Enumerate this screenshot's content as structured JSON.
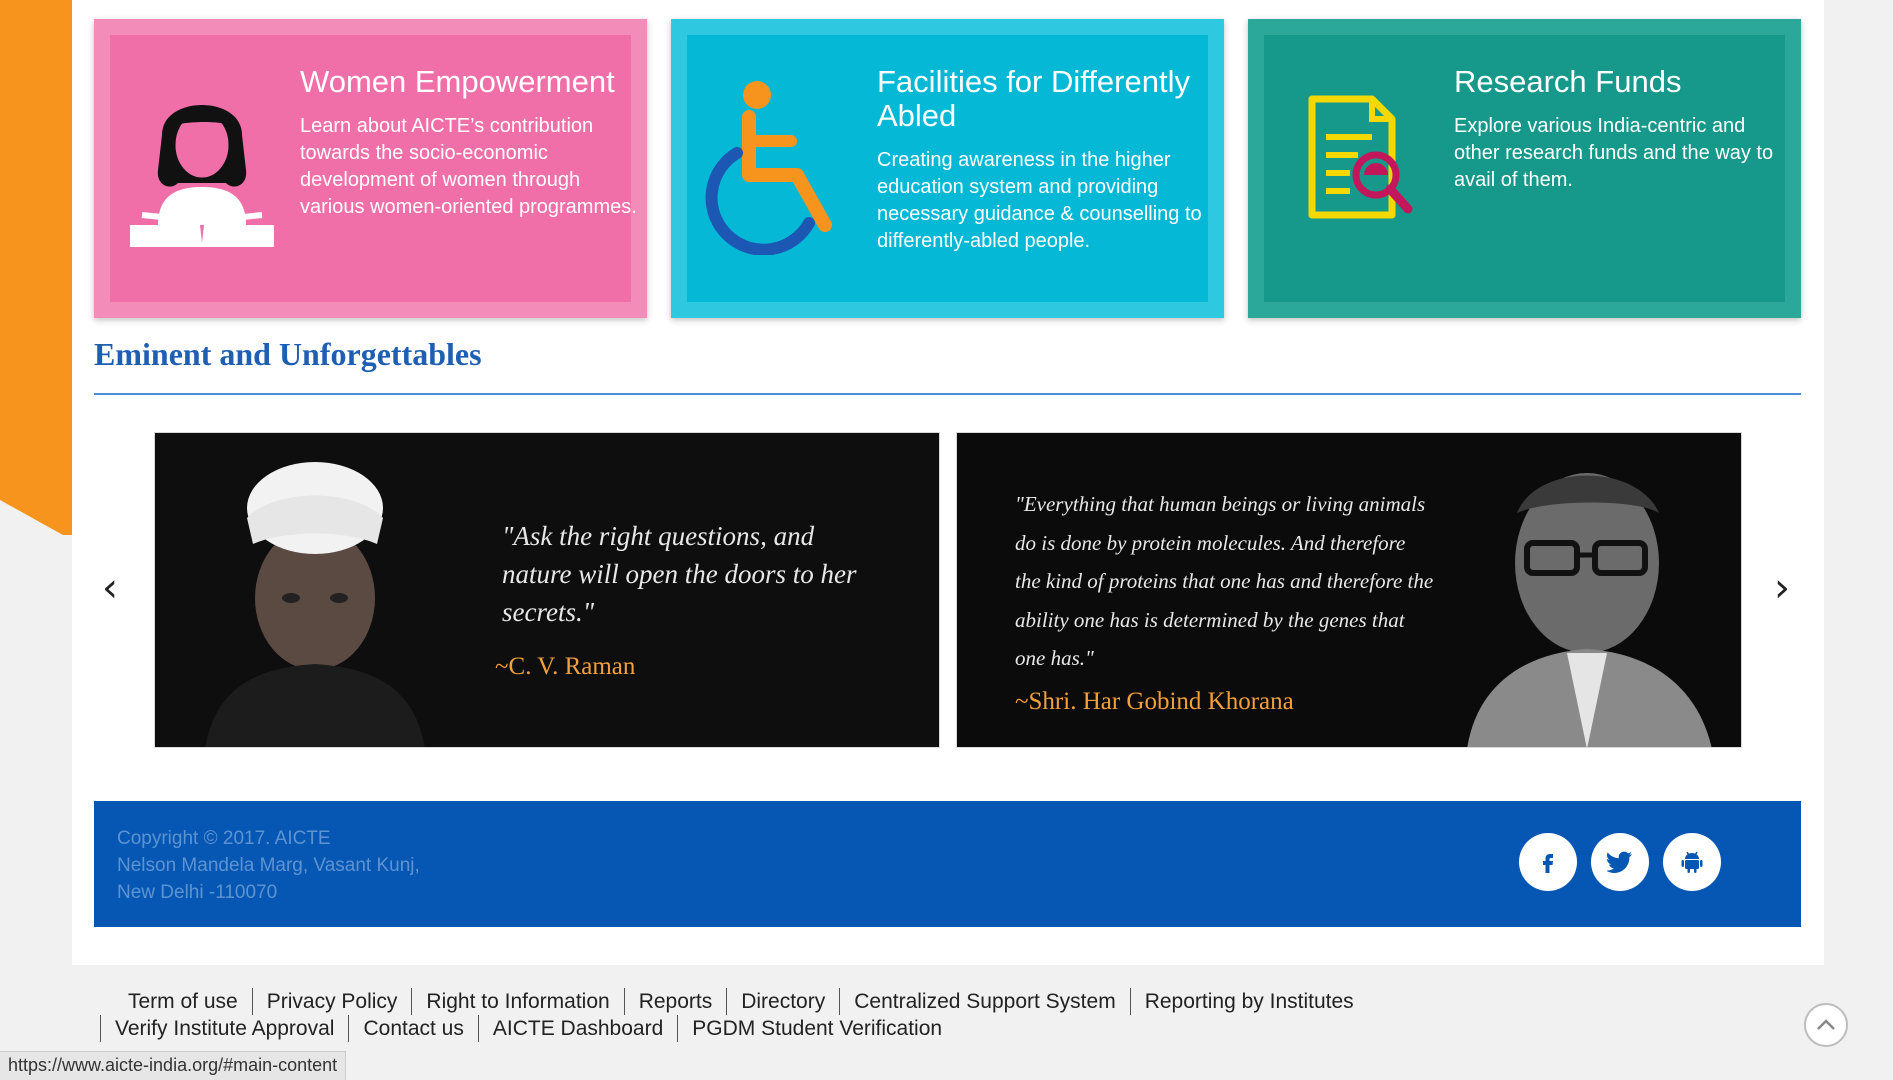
{
  "cards": [
    {
      "title": "Women Empowerment",
      "desc": "Learn about AICTE’s contribution towards the socio-economic development of women through various women-oriented programmes.",
      "icon": "woman-reading-icon"
    },
    {
      "title": "Facilities for Differently Abled",
      "desc": "Creating awareness in the higher education system and providing necessary guidance & counselling to differently-abled people.",
      "icon": "wheelchair-icon"
    },
    {
      "title": "Research Funds",
      "desc": "Explore various India-centric and other research funds and the way to avail of them.",
      "icon": "document-magnifier-icon"
    }
  ],
  "section": {
    "title": "Eminent and Unforgettables"
  },
  "carousel": {
    "prev": "‹",
    "next": "›",
    "slides": [
      {
        "quote": "\"Ask the right questions, and nature will open the doors to her secrets.\"",
        "author": "~C. V. Raman"
      },
      {
        "quote": "\"Everything that human beings or living animals do is done by protein molecules. And therefore the kind of proteins that one has and therefore the ability one has is determined by the genes that one has.\"",
        "author": "~Shri. Har Gobind Khorana"
      }
    ]
  },
  "footer": {
    "line1": "Copyright © 2017. AICTE",
    "line2": "Nelson Mandela Marg, Vasant Kunj,",
    "line3": "New Delhi -110070",
    "social": [
      "facebook-icon",
      "twitter-icon",
      "android-icon"
    ]
  },
  "links": {
    "row1": [
      "Term of use",
      "Privacy Policy",
      "Right to Information",
      "Reports",
      "Directory",
      "Centralized Support System",
      "Reporting by Institutes"
    ],
    "row2": [
      "Verify Institute Approval",
      "Contact us",
      "AICTE Dashboard",
      "PGDM Student Verification"
    ]
  },
  "status_url": "https://www.aicte-india.org/#main-content",
  "colors": {
    "orange": "#f7941d",
    "pink": "#f06fa8",
    "cyan": "#04b8d6",
    "teal": "#16988a",
    "footer_blue": "#0557b3",
    "heading_blue": "#1e5fb3"
  }
}
